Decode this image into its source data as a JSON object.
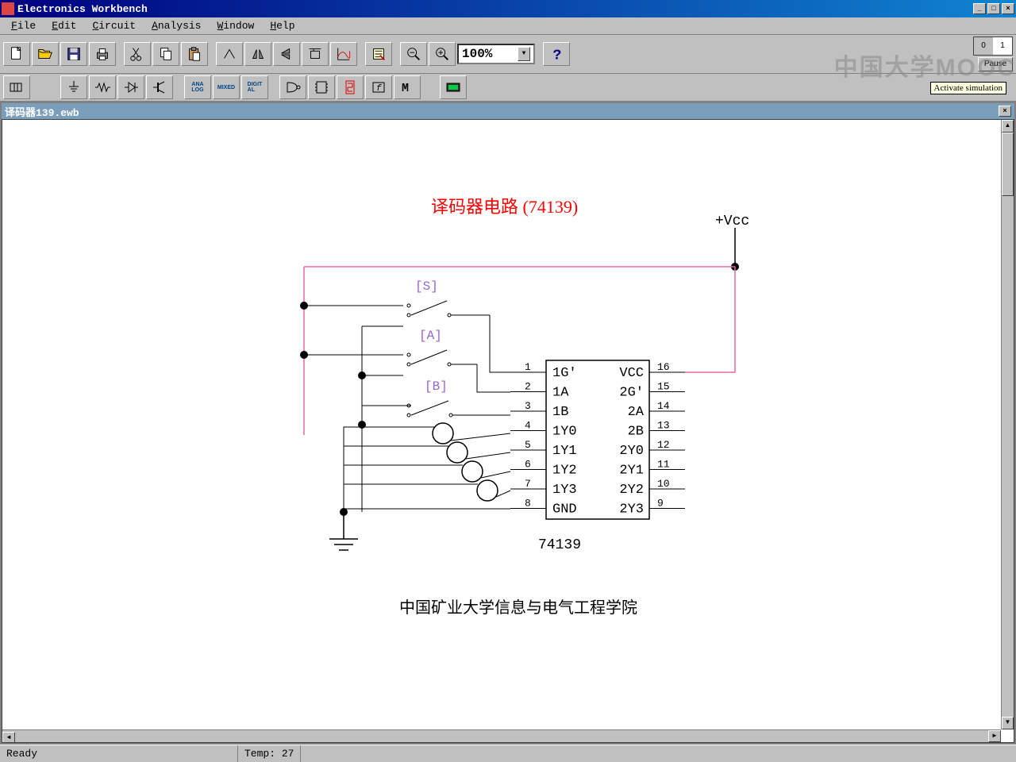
{
  "app": {
    "title": "Electronics Workbench"
  },
  "menu": {
    "file": "File",
    "edit": "Edit",
    "circuit": "Circuit",
    "analysis": "Analysis",
    "window": "Window",
    "help": "Help"
  },
  "toolbar": {
    "zoom": "100%"
  },
  "sim": {
    "tooltip": "Activate simulation",
    "pause": "Pause",
    "off": "0",
    "on": "1"
  },
  "doc": {
    "title": "译码器139.ewb"
  },
  "circuit": {
    "title": "译码器电路 (74139)",
    "caption": "中国矿业大学信息与电气工程学院",
    "vcc": "+Vcc",
    "switches": {
      "s": "[S]",
      "a": "[A]",
      "b": "[B]"
    },
    "chip": {
      "name": "74139",
      "left_pins": [
        {
          "n": "1",
          "l": "1G'"
        },
        {
          "n": "2",
          "l": "1A"
        },
        {
          "n": "3",
          "l": "1B"
        },
        {
          "n": "4",
          "l": "1Y0"
        },
        {
          "n": "5",
          "l": "1Y1"
        },
        {
          "n": "6",
          "l": "1Y2"
        },
        {
          "n": "7",
          "l": "1Y3"
        },
        {
          "n": "8",
          "l": "GND"
        }
      ],
      "right_pins": [
        {
          "n": "16",
          "l": "VCC"
        },
        {
          "n": "15",
          "l": "2G'"
        },
        {
          "n": "14",
          "l": "2A"
        },
        {
          "n": "13",
          "l": "2B"
        },
        {
          "n": "12",
          "l": "2Y0"
        },
        {
          "n": "11",
          "l": "2Y1"
        },
        {
          "n": "10",
          "l": "2Y2"
        },
        {
          "n": "9",
          "l": "2Y3"
        }
      ]
    }
  },
  "status": {
    "ready": "Ready",
    "temp_label": "Temp:",
    "temp": "27"
  },
  "watermark": "中国大学MOOC"
}
